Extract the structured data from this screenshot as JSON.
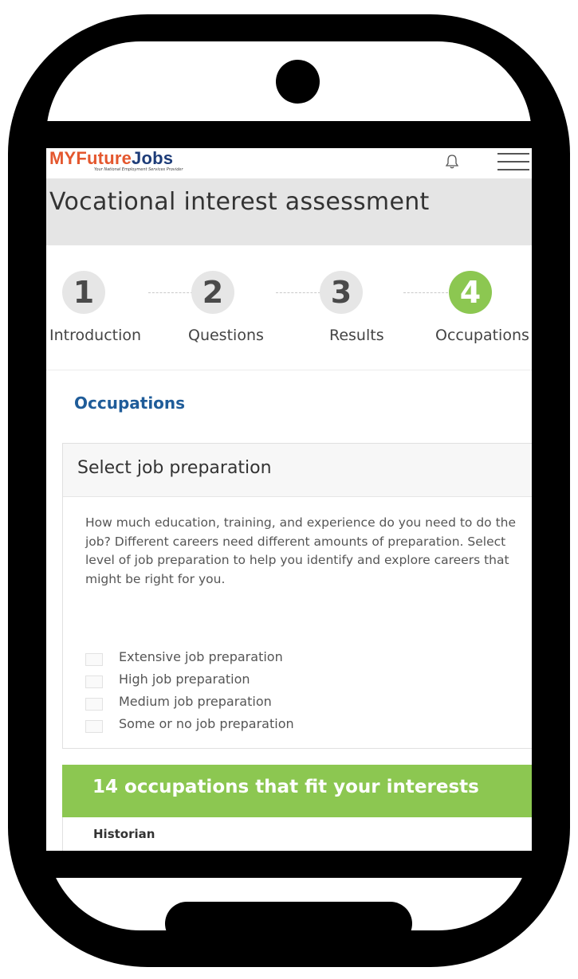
{
  "app": {
    "logo": {
      "part1": "MY",
      "part2": "Future",
      "part3": "Jobs",
      "tagline": "Your National Employment Services Provider"
    },
    "icons": {
      "notifications": "bell-icon",
      "menu": "hamburger-menu-icon"
    }
  },
  "page": {
    "title": "Vocational interest assessment"
  },
  "stepper": {
    "steps": [
      {
        "number": "1",
        "label": "Introduction",
        "active": false
      },
      {
        "number": "2",
        "label": "Questions",
        "active": false
      },
      {
        "number": "3",
        "label": "Results",
        "active": false
      },
      {
        "number": "4",
        "label": "Occupations",
        "active": true
      }
    ]
  },
  "section": {
    "heading": "Occupations"
  },
  "job_preparation": {
    "title": "Select job preparation",
    "description": "How much education, training, and experience do you need to do the job? Different careers need different amounts of preparation. Select level of job preparation to help you identify and explore careers that might be right for you.",
    "options": [
      {
        "label": "Extensive job preparation",
        "checked": false
      },
      {
        "label": "High job preparation",
        "checked": false
      },
      {
        "label": "Medium job preparation",
        "checked": false
      },
      {
        "label": "Some or no job preparation",
        "checked": false
      }
    ]
  },
  "results": {
    "heading": "14 occupations that fit your interests",
    "items": [
      {
        "name": "Historian"
      }
    ]
  },
  "colors": {
    "accent_green": "#8cc751",
    "link_blue": "#1f5c99",
    "logo_orange": "#e4572e",
    "logo_navy": "#1d3c78",
    "title_band": "#e5e5e5"
  }
}
